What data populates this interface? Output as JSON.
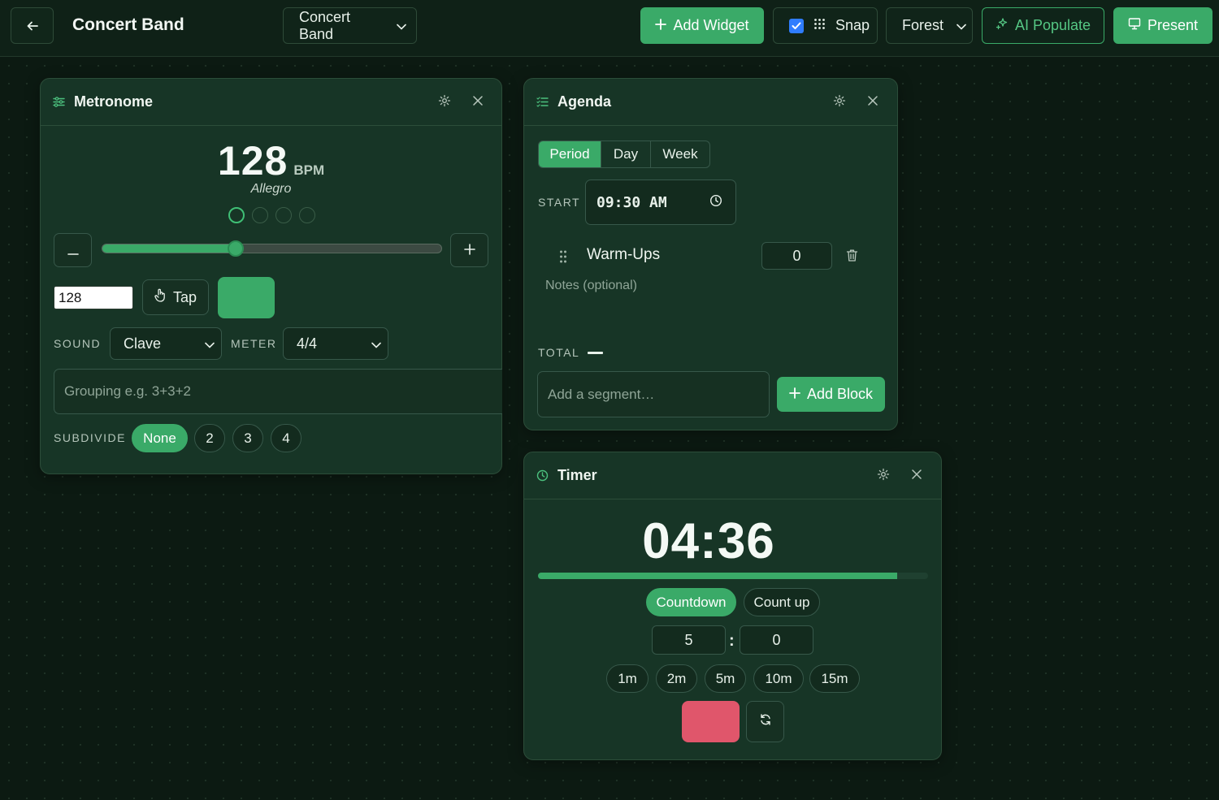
{
  "header": {
    "title": "Concert Band",
    "class_select": "Concert Band",
    "add_widget_label": "Add Widget",
    "snap_label": "Snap",
    "snap_checked": true,
    "theme_select": "Forest",
    "ai_label": "AI Populate",
    "present_label": "Present"
  },
  "metronome": {
    "title": "Metronome",
    "bpm": "128",
    "bpm_unit": "BPM",
    "tempo_name": "Allegro",
    "beats": 4,
    "active_beat": 1,
    "slider_fraction": 0.394,
    "bpm_input_value": "128",
    "tap_label": "Tap",
    "sound_label": "SOUND",
    "sound_value": "Clave",
    "meter_label": "METER",
    "meter_value": "4/4",
    "grouping_placeholder": "Grouping e.g. 3+3+2",
    "subdivide_label": "SUBDIVIDE",
    "subdivide_options": [
      "None",
      "2",
      "3",
      "4"
    ],
    "subdivide_selected": "None",
    "accent_color": "#3aaa68"
  },
  "agenda": {
    "title": "Agenda",
    "tabs": [
      "Period",
      "Day",
      "Week"
    ],
    "tab_selected": "Period",
    "start_label": "START",
    "start_time": "09:30 AM",
    "segment_name": "Warm-Ups",
    "segment_minutes": "0",
    "notes_placeholder": "Notes (optional)",
    "total_label": "TOTAL",
    "segment_placeholder": "Add a segment…",
    "add_block_label": "Add Block"
  },
  "timer": {
    "title": "Timer",
    "display": "04:36",
    "progress_fraction": 0.92,
    "modes": [
      "Countdown",
      "Count up"
    ],
    "mode_selected": "Countdown",
    "minutes": "5",
    "seconds": "0",
    "colon": ":",
    "presets": [
      "1m",
      "2m",
      "5m",
      "10m",
      "15m"
    ],
    "stop_color": "#e0566b"
  }
}
